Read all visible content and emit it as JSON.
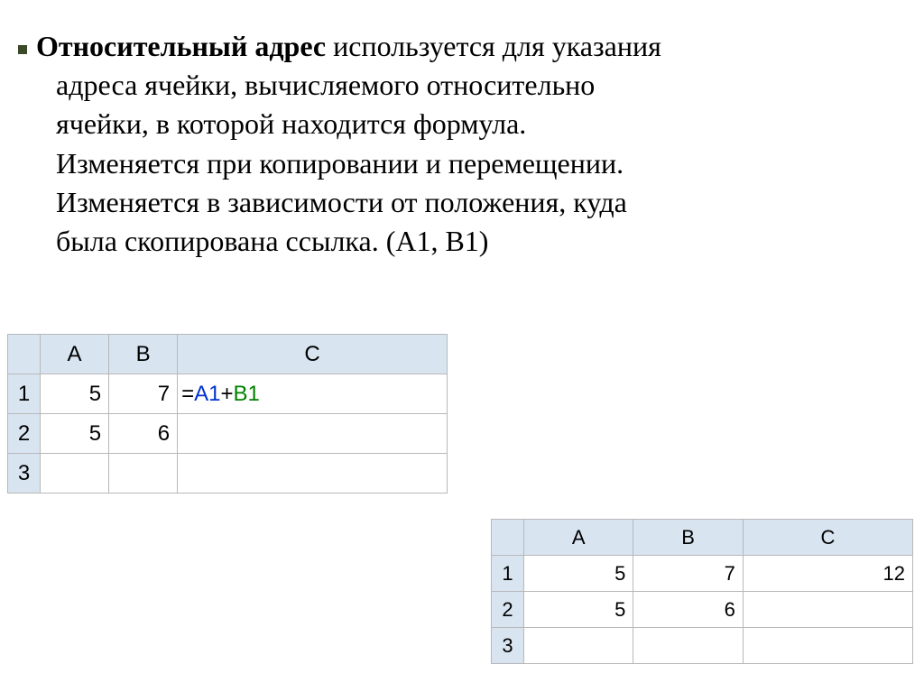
{
  "text": {
    "bold": "Относительный адрес",
    "rest1": " используется для указания",
    "line2": "адреса ячейки, вычисляемого относительно",
    "line3": "ячейки, в которой находится формула.",
    "line4": "Изменяется при копировании и перемещении.",
    "line5": "Изменяется в зависимости от положения, куда",
    "line6": "была скопирована ссылка. (А1, В1)"
  },
  "table1": {
    "colA": "A",
    "colB": "B",
    "colC": "C",
    "r1": "1",
    "r2": "2",
    "r3": "3",
    "a1": "5",
    "b1": "7",
    "a2": "5",
    "b2": "6",
    "formula_eq": "=",
    "formula_a": "A1",
    "formula_plus": "+",
    "formula_b": "B1"
  },
  "table2": {
    "colA": "A",
    "colB": "B",
    "colC": "C",
    "r1": "1",
    "r2": "2",
    "r3": "3",
    "a1": "5",
    "b1": "7",
    "c1": "12",
    "a2": "5",
    "b2": "6"
  }
}
